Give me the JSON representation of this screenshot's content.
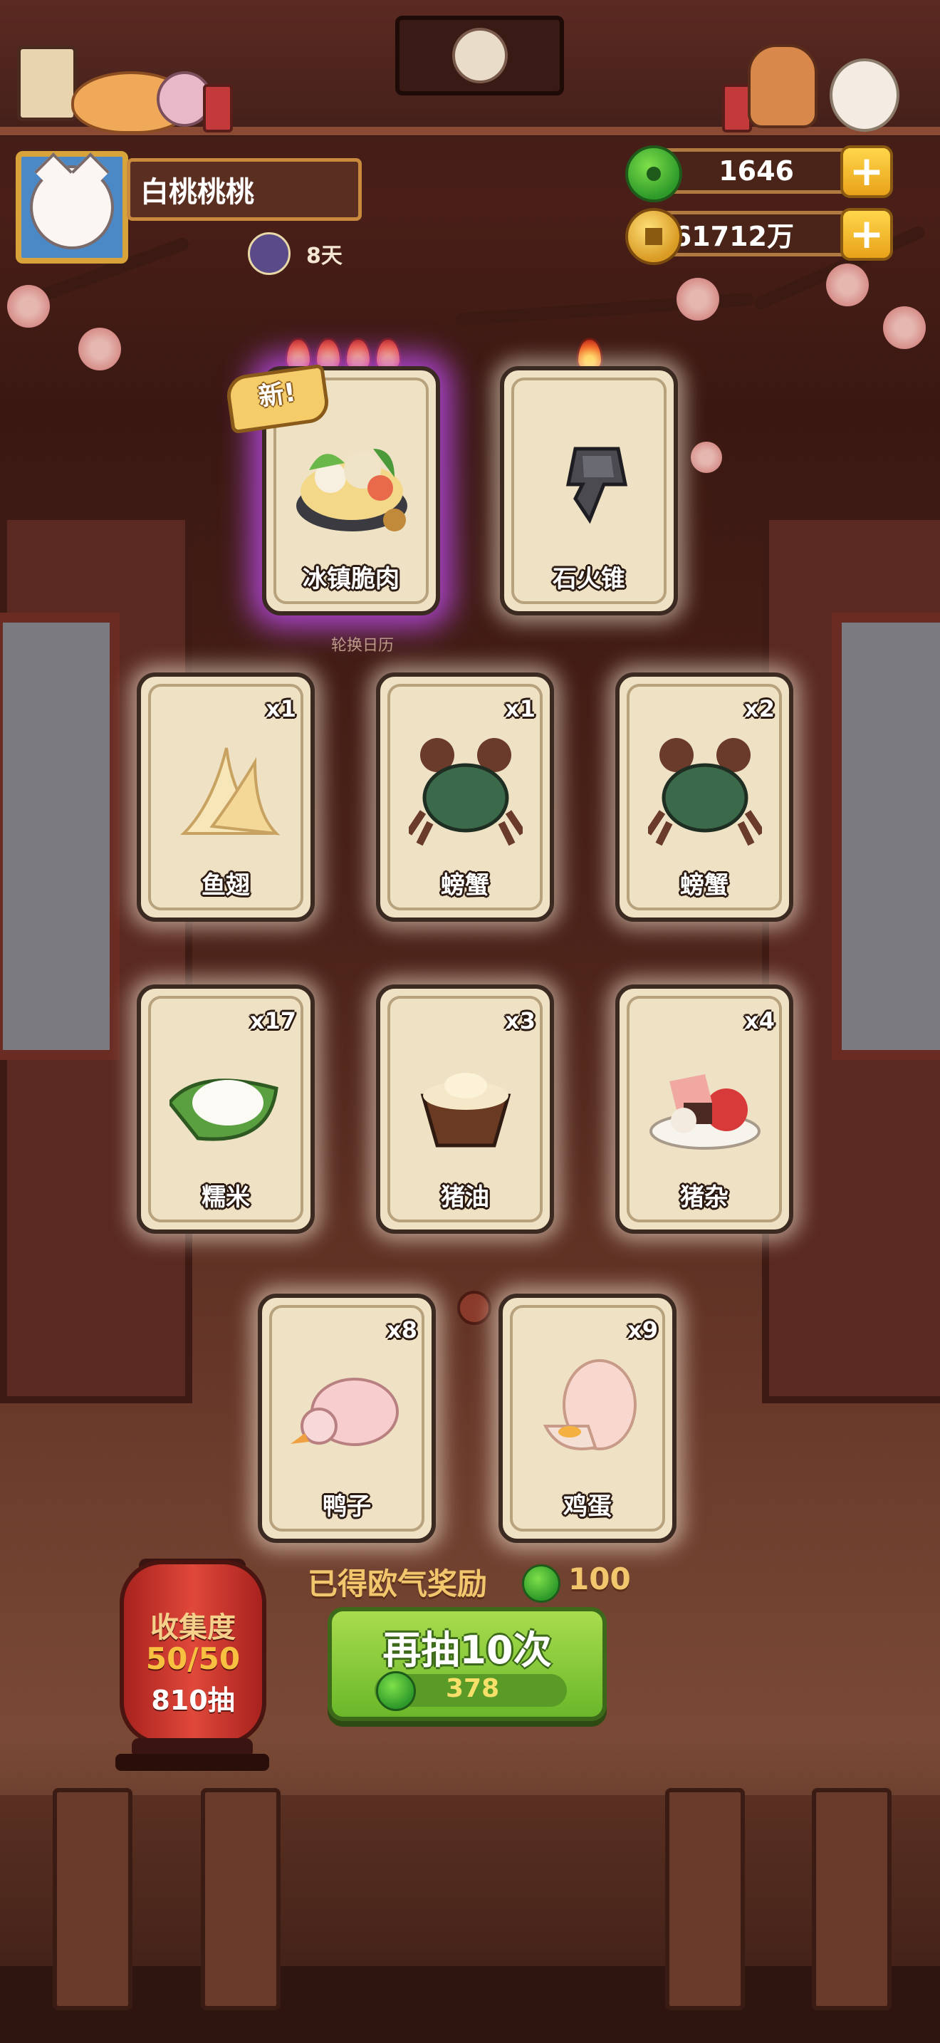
{
  "profile": {
    "name": "白桃桃桃",
    "days": "8天"
  },
  "currency": {
    "jade": "1646",
    "coins": "61712万"
  },
  "featured_cards": [
    {
      "name": "冰镇脆肉",
      "flames": 4,
      "is_new": true,
      "new_label": "新",
      "rarity": "purple"
    },
    {
      "name": "石火锥",
      "flames": 1,
      "is_new": false,
      "rarity": "normal"
    }
  ],
  "calendar_label": "轮换日历",
  "cards": [
    {
      "name": "鱼翅",
      "count": "x1",
      "icon": "shark-fin-icon"
    },
    {
      "name": "螃蟹",
      "count": "x1",
      "icon": "crab-icon"
    },
    {
      "name": "螃蟹",
      "count": "x2",
      "icon": "crab-icon"
    },
    {
      "name": "糯米",
      "count": "x17",
      "icon": "sticky-rice-icon"
    },
    {
      "name": "猪油",
      "count": "x3",
      "icon": "lard-icon"
    },
    {
      "name": "猪杂",
      "count": "x4",
      "icon": "pork-offal-icon"
    },
    {
      "name": "鸭子",
      "count": "x8",
      "icon": "duck-icon"
    },
    {
      "name": "鸡蛋",
      "count": "x9",
      "icon": "egg-icon"
    }
  ],
  "reward": {
    "label": "已得欧气奖励",
    "value": "100"
  },
  "collection": {
    "title": "收集度",
    "progress": "50/50",
    "draws": "810抽"
  },
  "draw_button": {
    "label": "再抽10次",
    "cost": "378"
  },
  "colors": {
    "accent_green": "#6ab82a",
    "gold": "#f2c66c",
    "lantern_red": "#e0483a",
    "rare_glow": "#c850ff"
  }
}
